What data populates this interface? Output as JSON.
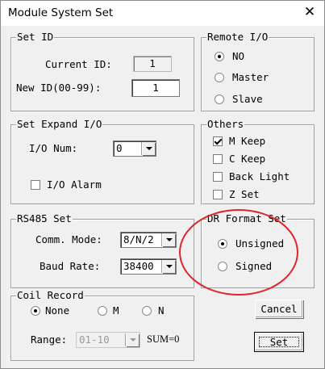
{
  "window": {
    "title": "Module System Set",
    "close_glyph": "✕"
  },
  "set_id": {
    "title": "Set ID",
    "current_label": "Current ID:",
    "current_value": "1",
    "new_label": "New ID(00-99):",
    "new_value": "1"
  },
  "remote_io": {
    "title": "Remote I/O",
    "options": [
      "NO",
      "Master",
      "Slave"
    ],
    "selected": "NO"
  },
  "expand_io": {
    "title": "Set Expand I/O",
    "num_label": "I/O Num:",
    "num_value": "0",
    "alarm_label": "I/O Alarm",
    "alarm_checked": false
  },
  "others": {
    "title": "Others",
    "items": [
      {
        "label": "M Keep",
        "checked": true
      },
      {
        "label": "C Keep",
        "checked": false
      },
      {
        "label": "Back Light",
        "checked": false
      },
      {
        "label": "Z Set",
        "checked": false
      }
    ]
  },
  "rs485": {
    "title": "RS485 Set",
    "mode_label": "Comm. Mode:",
    "mode_value": "8/N/2",
    "baud_label": "Baud Rate:",
    "baud_value": "38400"
  },
  "dr_format": {
    "title": "DR Format Set",
    "options": [
      "Unsigned",
      "Signed"
    ],
    "selected": "Unsigned"
  },
  "coil_record": {
    "title": "Coil Record",
    "options": [
      "None",
      "M",
      "N"
    ],
    "selected": "None",
    "range_label": "Range:",
    "range_value": "01-10",
    "sum_text": "SUM=0"
  },
  "buttons": {
    "cancel": "Cancel",
    "set": "Set"
  },
  "colors": {
    "annotation": "#e0242b",
    "dialog_bg": "#f0f0f0"
  }
}
